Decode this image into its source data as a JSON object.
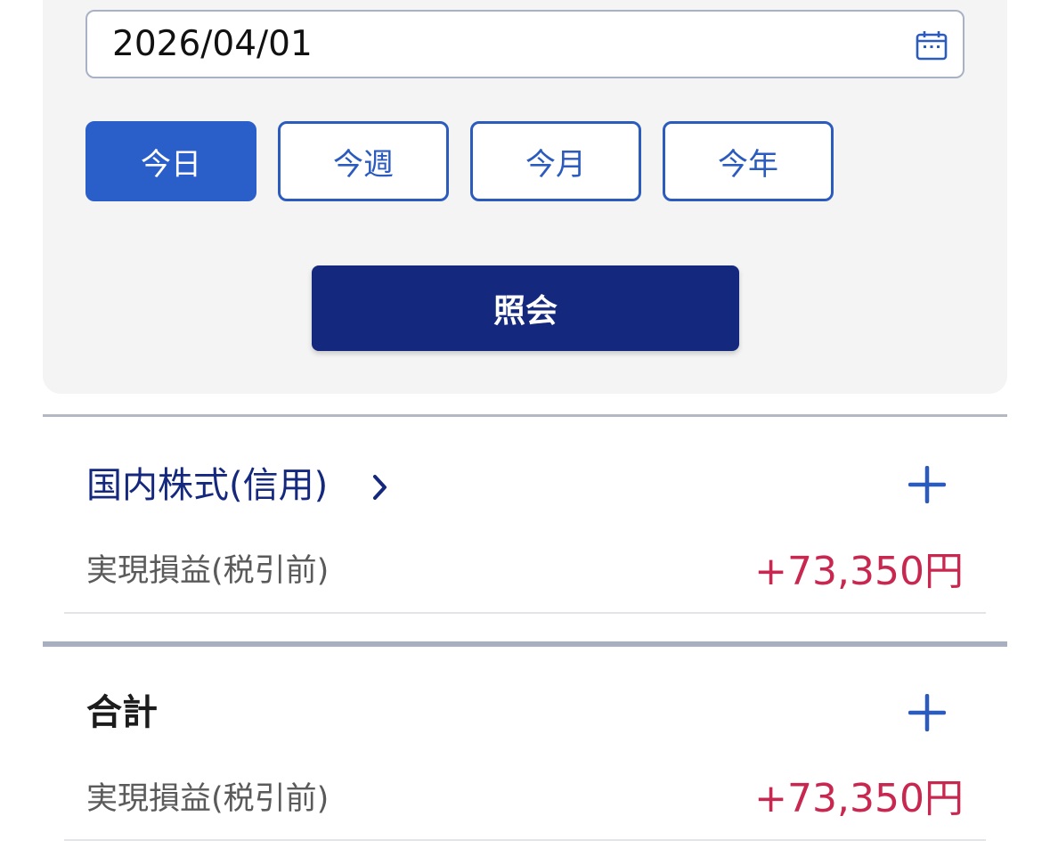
{
  "filter": {
    "date_value": "2026/04/01",
    "range_buttons": [
      "今日",
      "今週",
      "今月",
      "今年"
    ],
    "active_range_index": 0,
    "submit_label": "照会"
  },
  "sections": [
    {
      "title": "国内株式(信用)",
      "label": "実現損益(税引前)",
      "amount": "+73,350円"
    },
    {
      "title": "合計",
      "label": "実現損益(税引前)",
      "amount": "+73,350円"
    }
  ],
  "icons": {
    "calendar": "calendar-icon",
    "chevron": "chevron-right-icon",
    "expand": "plus-icon"
  },
  "colors": {
    "accent": "#2a5fc9",
    "primary_button": "#14287e",
    "positive_amount": "#c8274f"
  }
}
